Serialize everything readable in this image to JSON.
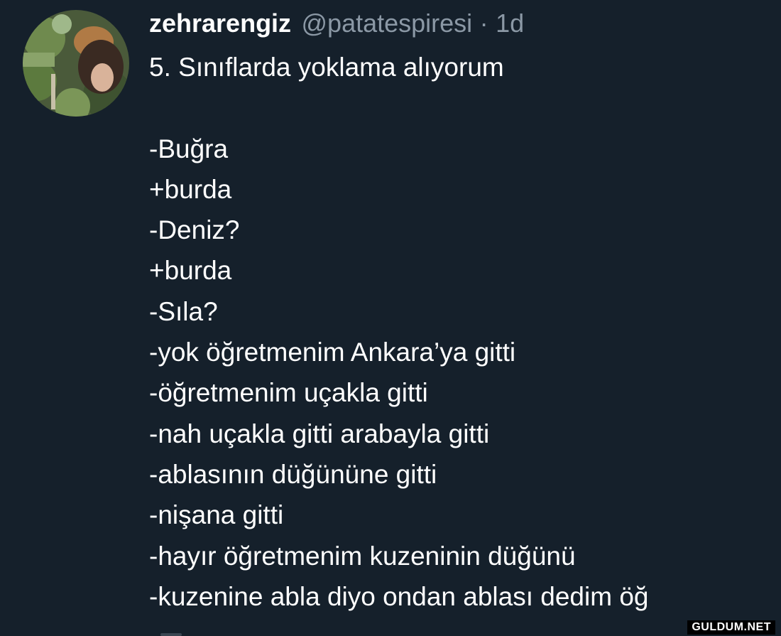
{
  "tweet": {
    "display_name": "zehrarengiz",
    "handle": "@patatespiresi",
    "separator": "·",
    "time": "1d",
    "lines": [
      "5. Sınıflarda yoklama alıyorum",
      "",
      "-Buğra",
      "+burda",
      "-Deniz?",
      "+burda",
      "-Sıla?",
      "-yok öğretmenim Ankara’ya gitti",
      "-öğretmenim uçakla gitti",
      "-nah uçakla gitti arabayla gitti",
      "-ablasının düğününe gitti",
      "-nişana gitti",
      "-hayır öğretmenim kuzeninin düğünü",
      "-kuzenine abla diyo ondan ablası dedim öğ"
    ]
  },
  "watermark": "GULDUM.NET",
  "colors": {
    "background": "#15202b",
    "primary_text": "#ffffff",
    "secondary_text": "#8b98a5"
  }
}
